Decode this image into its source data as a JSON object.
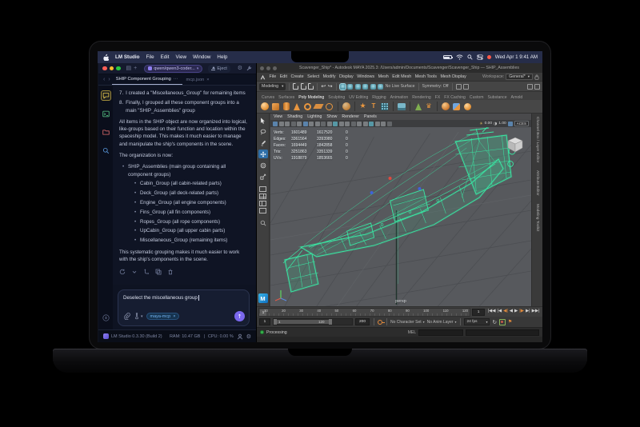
{
  "menubar": {
    "app_name": "LM Studio",
    "items": [
      "File",
      "Edit",
      "View",
      "Window",
      "Help"
    ],
    "clock": "Wed Apr 1  9:41 AM"
  },
  "lmstudio": {
    "titlebar": {
      "model": "qwen/qwen3-coder...",
      "eject_label": "Eject"
    },
    "tabs": {
      "active": "SHIP Component Grouping",
      "secondary": "mcp.json"
    },
    "chat": {
      "item7_num": "7.",
      "item7": "I created a \"Miscellaneous_Group\" for remaining items",
      "item8_num": "8.",
      "item8": "Finally, I grouped all these component groups into a main \"SHIP_Assemblies\" group",
      "para1": "All items in the SHIP object are now organized into logical, like-groups based on their function and location within the spaceship model. This makes it much easier to manage and manipulate the ship's components in the scene.",
      "para2": "The organization is now:",
      "main_group": "SHIP_Assemblies (main group containing all component groups)",
      "subgroups": [
        "Cabin_Group (all cabin-related parts)",
        "Deck_Group (all deck-related parts)",
        "Engine_Group (all engine components)",
        "Fins_Group (all fin components)",
        "Ropes_Group (all rope components)",
        "UpCabin_Group (all upper cabin parts)",
        "Miscellaneous_Group (remaining items)"
      ],
      "para3": "This systematic grouping makes it much easier to work with the ship's components in the scene."
    },
    "composer": {
      "value": "Deselect the miscellaneous group",
      "chip": "maya-mcp"
    },
    "status": {
      "version": "LM Studio 0.3.30 (Build 2)",
      "ram": "RAM: 10.47 GB",
      "cpu": "CPU: 0.00 %"
    }
  },
  "maya": {
    "title": "Scavenger_Ship* - Autodesk MAYA 2025.3: /Users/admin/Documents/Scavenger/Scavenger_Ship — SHIP_Assemblies",
    "menu": [
      "File",
      "Edit",
      "Create",
      "Select",
      "Modify",
      "Display",
      "Windows",
      "Mesh",
      "Edit Mesh",
      "Mesh Tools",
      "Mesh Display"
    ],
    "workspace_label": "Workspace:",
    "workspace": "General*",
    "mode": "Modeling",
    "no_live_surface": "No Live Surface",
    "symmetry": "Symmetry: Off",
    "shelf_tabs": [
      "Curves",
      "Surfaces",
      "Poly Modeling",
      "Sculpting",
      "UV Editing",
      "Rigging",
      "Animation",
      "Rendering",
      "FX",
      "FX Caching",
      "Custom",
      "Substance",
      "Arnold"
    ],
    "panel_menus": [
      "View",
      "Shading",
      "Lighting",
      "Show",
      "Renderer",
      "Panels"
    ],
    "viewport": {
      "exposure": "0.00",
      "gamma": "1.00",
      "color_space": "ACES",
      "camera": "persp",
      "hud": {
        "rows": [
          [
            "Verts:",
            "1601489",
            "1617520",
            "0"
          ],
          [
            "Edges:",
            "3361564",
            "3393980",
            "0"
          ],
          [
            "Faces:",
            "1694449",
            "1842858",
            "0"
          ],
          [
            "Tris:",
            "3251863",
            "3351339",
            "0"
          ],
          [
            "UVs:",
            "1918879",
            "1853665",
            "0"
          ]
        ]
      }
    },
    "side_tabs": [
      "Channel Box / Layer Editor",
      "Attribute Editor",
      "Modeling Toolkit"
    ],
    "timeline": {
      "ticks": [
        "10",
        "20",
        "30",
        "40",
        "50",
        "60",
        "70",
        "80",
        "90",
        "100",
        "110",
        "120"
      ],
      "current": "1"
    },
    "range": {
      "anim_start": "1",
      "play_start": "1",
      "play_end": "120",
      "anim_end": "200",
      "character_set": "No Character Set",
      "anim_layer": "No Anim Layer",
      "fps": "24 fps"
    },
    "command": {
      "status": "Processing",
      "mel_label": "MEL"
    }
  },
  "colors": {
    "accent_purple": "#7a68ee",
    "ship_green": "#39e8a4",
    "shelf_orange": "#e8963f",
    "chip_blue": "#74b4f2"
  }
}
